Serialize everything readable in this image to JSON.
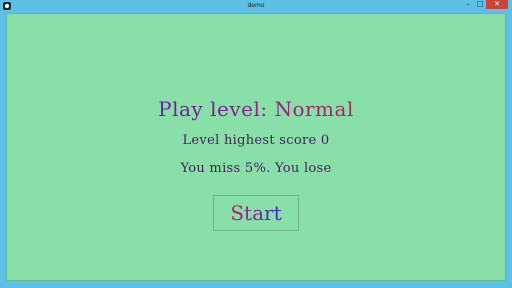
{
  "window": {
    "title": "demo",
    "controls": {
      "minimize": "–",
      "maximize": "□",
      "close": "✕"
    }
  },
  "game": {
    "level_title": "Play level: Normal",
    "highest_score": "Level highest score 0",
    "status": "You miss 5%. You lose",
    "start_label": "Start"
  },
  "colors": {
    "background": "#88dfa8",
    "window_frame": "#5ec0e6",
    "close_button": "#c7443c",
    "text_dark_purple": "#4a1a5e"
  }
}
